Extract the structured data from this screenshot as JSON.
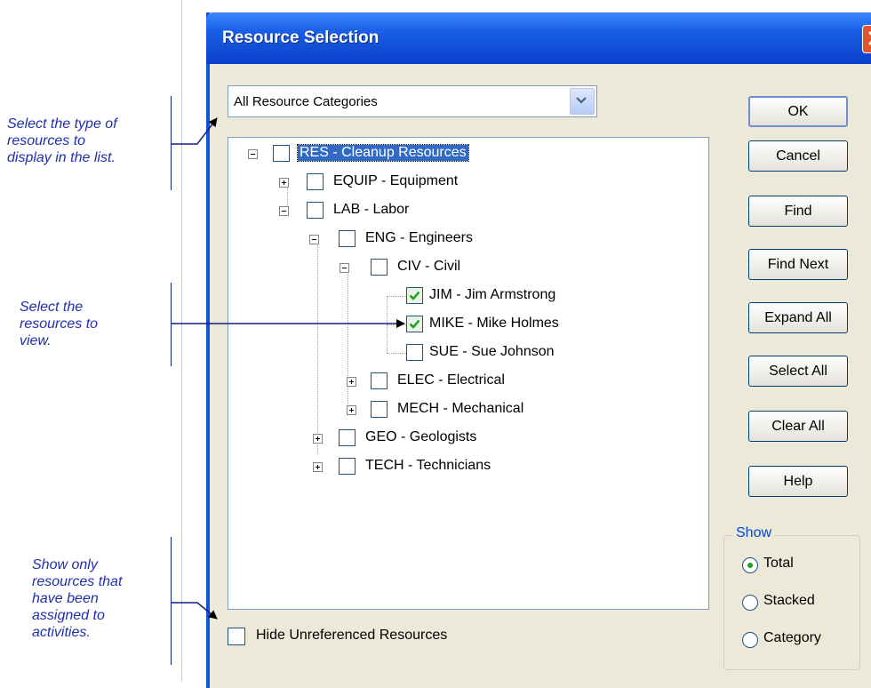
{
  "dialog": {
    "title": "Resource Selection",
    "close_icon": "close-icon",
    "category_dropdown": {
      "selected": "All Resource Categories"
    }
  },
  "tree": {
    "nodes": [
      {
        "label": "RES - Cleanup Resources",
        "checked": false,
        "expander": "minus",
        "selected": true
      },
      {
        "label": "EQUIP - Equipment",
        "checked": false,
        "expander": "plus"
      },
      {
        "label": "LAB - Labor",
        "checked": false,
        "expander": "minus"
      },
      {
        "label": "ENG - Engineers",
        "checked": false,
        "expander": "minus"
      },
      {
        "label": "CIV - Civil",
        "checked": false,
        "expander": "minus"
      },
      {
        "label": "JIM - Jim Armstrong",
        "checked": true
      },
      {
        "label": "MIKE - Mike Holmes",
        "checked": true
      },
      {
        "label": "SUE - Sue Johnson",
        "checked": false
      },
      {
        "label": "ELEC - Electrical",
        "checked": false,
        "expander": "plus"
      },
      {
        "label": "MECH - Mechanical",
        "checked": false,
        "expander": "plus"
      },
      {
        "label": "GEO - Geologists",
        "checked": false,
        "expander": "plus"
      },
      {
        "label": "TECH - Technicians",
        "checked": false,
        "expander": "plus"
      }
    ]
  },
  "buttons": {
    "ok": "OK",
    "cancel": "Cancel",
    "find": "Find",
    "find_next": "Find Next",
    "expand_all": "Expand All",
    "select_all": "Select All",
    "clear_all": "Clear All",
    "help": "Help"
  },
  "show_group": {
    "title": "Show",
    "options": [
      "Total",
      "Stacked",
      "Category"
    ],
    "selected": "Total"
  },
  "hide_unreferenced": {
    "label": "Hide Unreferenced Resources",
    "checked": false
  },
  "annotations": {
    "type": [
      "Select the type of",
      "resources to",
      "display in the list."
    ],
    "resources": [
      "Select the",
      "resources to",
      "view."
    ],
    "assigned": [
      "Show only",
      "resources that",
      "have been",
      "assigned to",
      "activities."
    ]
  },
  "colors": {
    "titlebar": "#0a3fc8",
    "annotation_text": "#1f2fb0",
    "dialog_bg": "#ece9d8",
    "selected_node": "#316ac5",
    "check_mark": "#21a121"
  }
}
